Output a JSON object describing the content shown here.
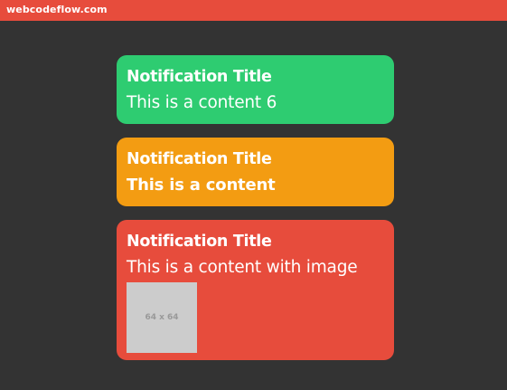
{
  "site": {
    "brand": "webcodeflow.com"
  },
  "colors": {
    "brand": "#e74c3c",
    "background": "#333333",
    "success": "#2ecc71",
    "warning": "#f39c12",
    "danger": "#e74c3c"
  },
  "notifications": [
    {
      "variant": "success",
      "title": "Notification Title",
      "content": "This is a content 6"
    },
    {
      "variant": "warning",
      "title": "Notification Title",
      "content": "This is a content"
    },
    {
      "variant": "danger",
      "title": "Notification Title",
      "content": "This is a content with image",
      "image_placeholder": "64 x 64"
    }
  ]
}
